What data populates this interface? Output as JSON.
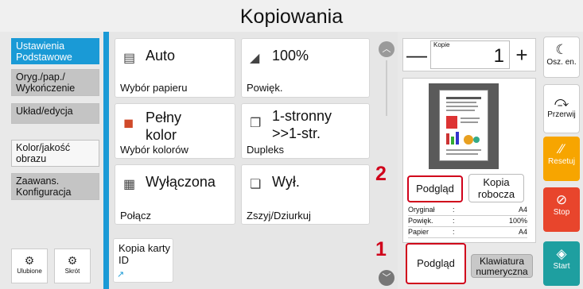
{
  "app": {
    "title": "Kopiowania"
  },
  "sidebar": {
    "items": [
      {
        "label": "Ustawienia Podstawowe"
      },
      {
        "label": "Oryg./pap./ Wykończenie"
      },
      {
        "label": "Układ/edycja"
      },
      {
        "label": "Kolor/jakość obrazu"
      },
      {
        "label": "Zaawans. Konfiguracja"
      }
    ],
    "favorites_label": "Ulubione",
    "shortcut_label": "Skrót"
  },
  "tiles": {
    "paper": {
      "value": "Auto",
      "label": "Wybór papieru"
    },
    "zoom": {
      "value": "100%",
      "label": "Powięk."
    },
    "color": {
      "value": "Pełny kolor",
      "label": "Wybór kolorów"
    },
    "duplex": {
      "value": "1-stronny >>1-str.",
      "label": "Dupleks"
    },
    "combine": {
      "value": "Wyłączona",
      "label": "Połącz"
    },
    "staple": {
      "value": "Wył.",
      "label": "Zszyj/Dziurkuj"
    },
    "id_copy": {
      "label": "Kopia karty ID"
    }
  },
  "copies": {
    "label": "Kopie",
    "value": "1",
    "minus": "—",
    "plus": "+"
  },
  "preview": {
    "preview_button": "Podgląd",
    "draft_button": "Kopia robocza",
    "info": [
      {
        "key": "Oryginał",
        "colon": ":",
        "value": "A4"
      },
      {
        "key": "Powięk.",
        "colon": ":",
        "value": "100%"
      },
      {
        "key": "Papier",
        "colon": ":",
        "value": "A4"
      }
    ]
  },
  "bottom": {
    "preview_button": "Podgląd",
    "keypad_button": "Klawiatura numeryczna"
  },
  "badges": {
    "one": "1",
    "two": "2"
  },
  "functions": {
    "sleep": "Osz. en.",
    "interrupt": "Przerwij",
    "reset": "Resetuj",
    "stop": "Stop",
    "start": "Start"
  },
  "colors": {
    "accent": "#1a9ad6",
    "highlight": "#d0021b",
    "reset": "#f7a500",
    "stop": "#e8452c",
    "start": "#1e9fa0"
  }
}
